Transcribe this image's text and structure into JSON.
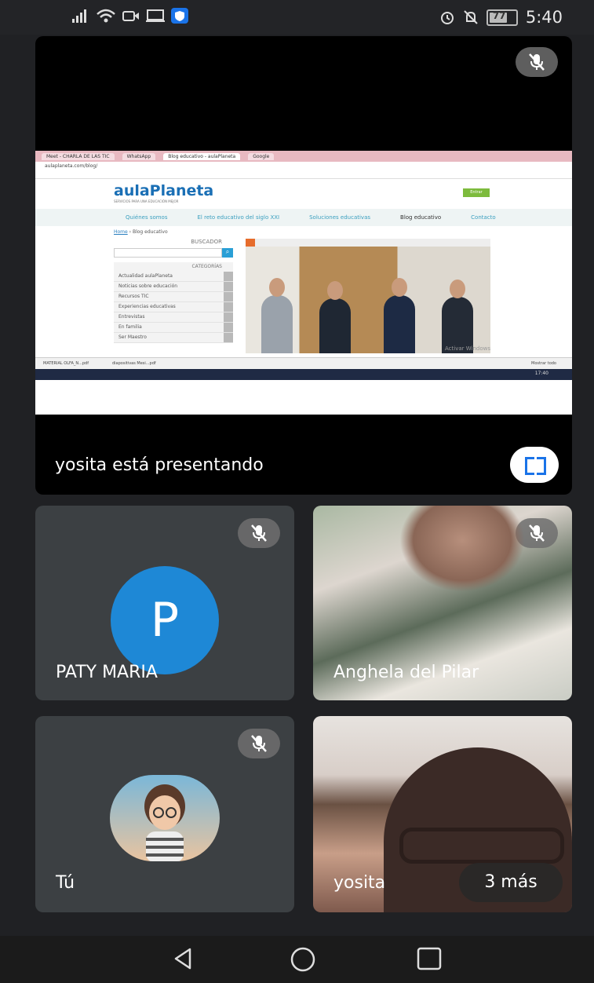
{
  "status_bar": {
    "battery": "77",
    "time": "5:40"
  },
  "presentation": {
    "presenter_text": "yosita está presentando",
    "shared_screen": {
      "tabs": [
        "Meet - CHARLA DE LAS TIC",
        "WhatsApp",
        "Blog educativo - aulaPlaneta",
        "Google"
      ],
      "url": "aulaplaneta.com/blog/",
      "site_logo": "aulaPlaneta",
      "site_tagline": "SERVICIOS PARA UNA EDUCACIÓN MEJOR",
      "site_button": "Entrar",
      "nav_items": [
        "Quiénes somos",
        "El reto educativo del siglo XXI",
        "Soluciones educativas",
        "Blog educativo",
        "Contacto"
      ],
      "breadcrumb": {
        "home": "Home",
        "current": "Blog educativo"
      },
      "search_label": "BUSCADOR",
      "categories_label": "CATEGORÍAS",
      "categories": [
        "Actualidad aulaPlaneta",
        "Noticias sobre educación",
        "Recursos TIC",
        "Experiencias educativas",
        "Entrevistas",
        "En familia",
        "Ser Maestro"
      ],
      "downloads": [
        "MATERIAL OLFA_N...pdf",
        "diapositivas Mesi...pdf"
      ],
      "show_all": "Mostrar todo",
      "watermark": "Activar Windows",
      "clock": "17:40"
    }
  },
  "participants": [
    {
      "name": "PATY MARIA",
      "initial": "P",
      "muted": true
    },
    {
      "name": "Anghela del Pilar",
      "muted": true
    },
    {
      "name": "Tú",
      "muted": true
    },
    {
      "name": "yosita",
      "more_label": "3 más"
    }
  ]
}
